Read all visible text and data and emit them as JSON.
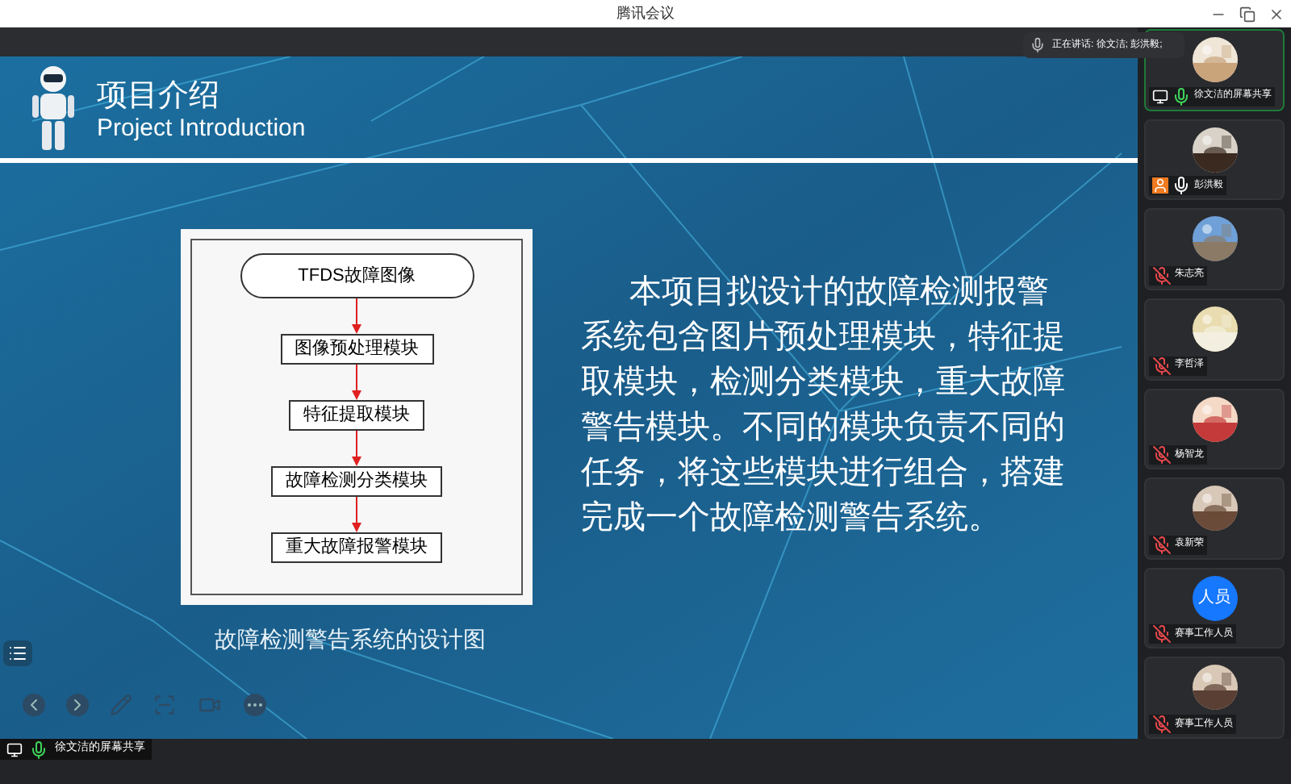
{
  "window": {
    "title": "腾讯会议"
  },
  "speaking": {
    "text": "正在讲话: 徐文洁; 彭洪毅;"
  },
  "slide": {
    "title": "项目介绍",
    "subtitle": "Project Introduction",
    "flowchart": [
      {
        "kind": "start",
        "label": "TFDS故障图像"
      },
      {
        "kind": "process",
        "label": "图像预处理模块"
      },
      {
        "kind": "process",
        "label": "特征提取模块"
      },
      {
        "kind": "process",
        "label": "故障检测分类模块"
      },
      {
        "kind": "process",
        "label": "重大故障报警模块"
      }
    ],
    "caption": "故障检测警告系统的设计图",
    "paragraph": "本项目拟设计的故障检测报警系统包含图片预处理模块，特征提取模块，检测分类模块，重大故障警告模块。不同的模块负责不同的任务，将这些模块进行组合，搭建完成一个故障检测警告系统。"
  },
  "participants": [
    {
      "name": "徐文洁的屏幕共享",
      "muted": false,
      "speaking": true,
      "sharing": true,
      "host": false,
      "selected": true
    },
    {
      "name": "彭洪毅",
      "muted": false,
      "speaking": false,
      "sharing": false,
      "host": true,
      "selected": false
    },
    {
      "name": "朱志亮",
      "muted": true,
      "speaking": false,
      "sharing": false,
      "host": false,
      "selected": false
    },
    {
      "name": "李哲泽",
      "muted": true,
      "speaking": false,
      "sharing": false,
      "host": false,
      "selected": false
    },
    {
      "name": "杨智龙",
      "muted": true,
      "speaking": false,
      "sharing": false,
      "host": false,
      "selected": false
    },
    {
      "name": "袁新荣",
      "muted": true,
      "speaking": false,
      "sharing": false,
      "host": false,
      "selected": false
    },
    {
      "name": "赛事工作人员",
      "muted": true,
      "speaking": false,
      "sharing": false,
      "host": false,
      "initials": "人员",
      "selected": false
    },
    {
      "name": "赛事工作人员",
      "muted": true,
      "speaking": false,
      "sharing": false,
      "host": false,
      "selected": false
    }
  ],
  "share_label": {
    "text": "徐文洁的屏幕共享",
    "speaking": true
  }
}
